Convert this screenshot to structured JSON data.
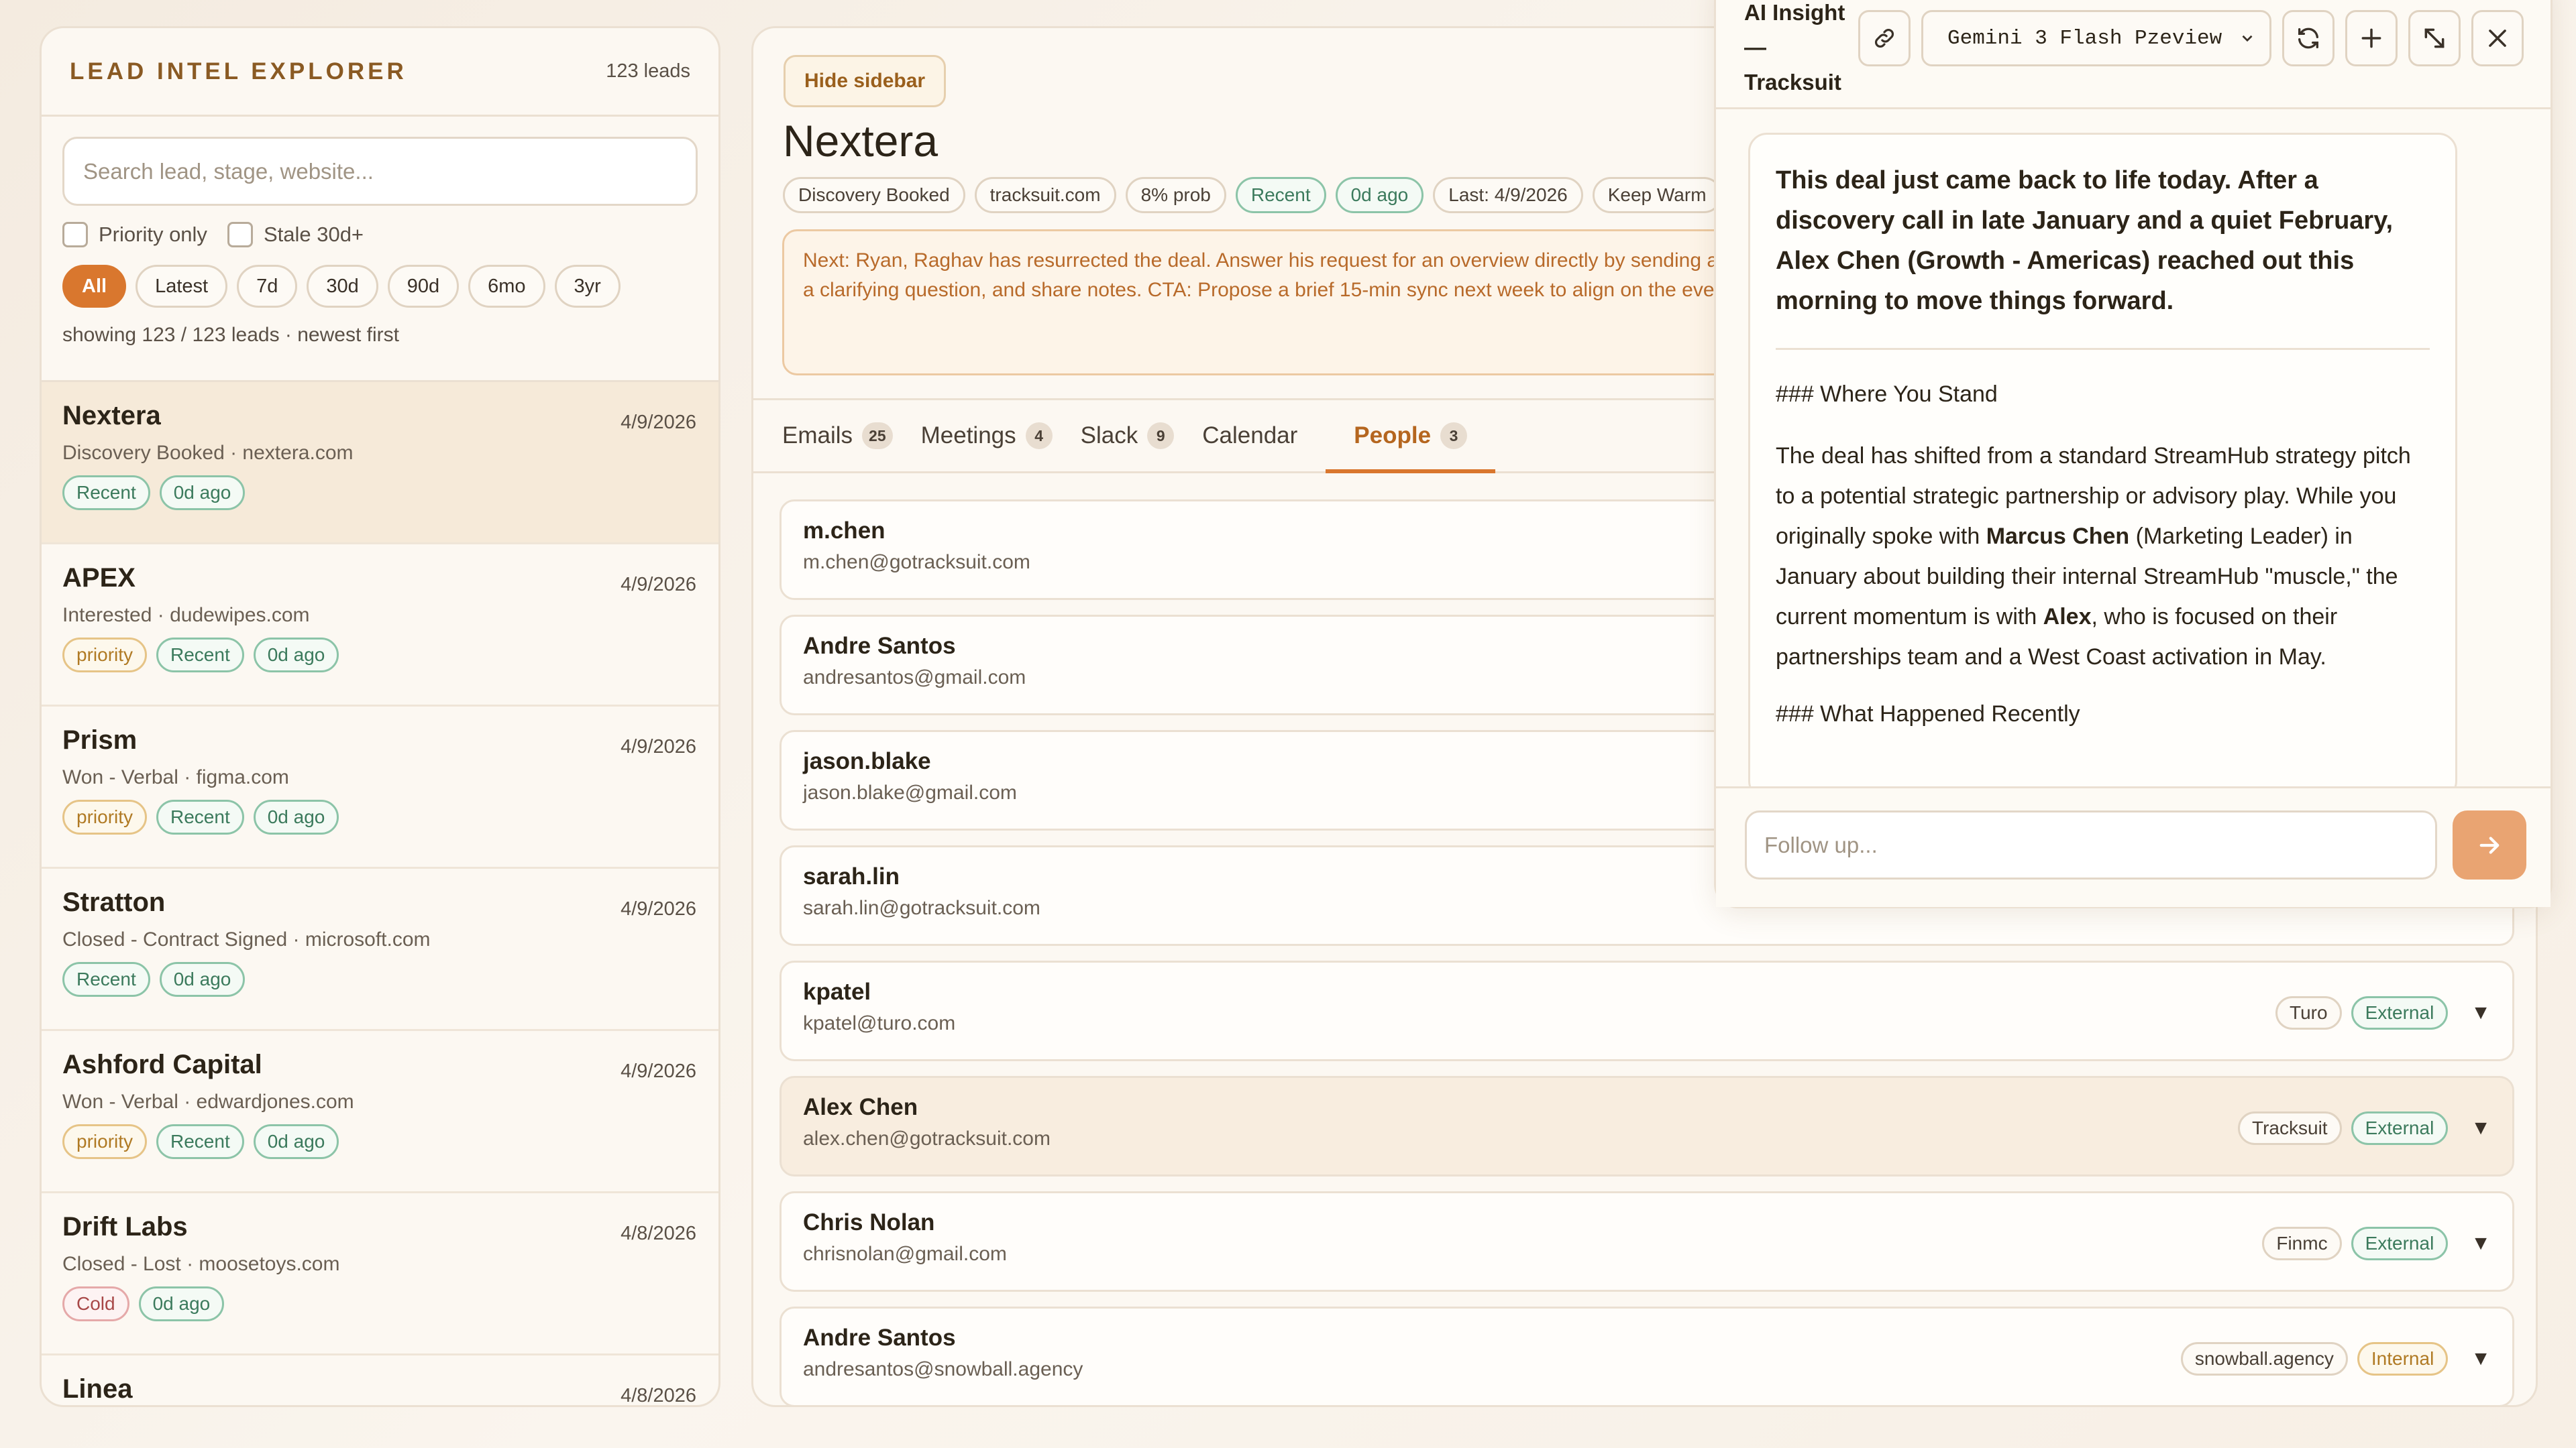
{
  "sidebar": {
    "title": "LEAD INTEL EXPLORER",
    "count": "123 leads",
    "search_placeholder": "Search lead, stage, website...",
    "priority_only": "Priority only",
    "stale": "Stale 30d+",
    "filters": [
      "All",
      "Latest",
      "7d",
      "30d",
      "90d",
      "6mo",
      "3yr"
    ],
    "active_filter": "All",
    "showing": "showing 123 / 123 leads · newest first",
    "leads": [
      {
        "name": "Nextera",
        "date": "4/9/2026",
        "sub": "Discovery Booked · nextera.com",
        "tags": [
          "Recent",
          "0d ago"
        ],
        "selected": true
      },
      {
        "name": "APEX",
        "date": "4/9/2026",
        "sub": "Interested · dudewipes.com",
        "tags": [
          "priority",
          "Recent",
          "0d ago"
        ]
      },
      {
        "name": "Prism",
        "date": "4/9/2026",
        "sub": "Won - Verbal · figma.com",
        "tags": [
          "priority",
          "Recent",
          "0d ago"
        ]
      },
      {
        "name": "Stratton",
        "date": "4/9/2026",
        "sub": "Closed - Contract Signed · microsoft.com",
        "tags": [
          "Recent",
          "0d ago"
        ]
      },
      {
        "name": "Ashford Capital",
        "date": "4/9/2026",
        "sub": "Won - Verbal · edwardjones.com",
        "tags": [
          "priority",
          "Recent",
          "0d ago"
        ]
      },
      {
        "name": "Drift Labs",
        "date": "4/8/2026",
        "sub": "Closed - Lost · moosetoys.com",
        "tags": [
          "Cold",
          "0d ago"
        ]
      },
      {
        "name": "Linea",
        "date": "4/8/2026",
        "sub": "",
        "tags": []
      }
    ]
  },
  "main": {
    "hide_sidebar": "Hide sidebar",
    "title": "Nextera",
    "chips": [
      "Discovery Booked",
      "tracksuit.com",
      "8% prob",
      "Recent",
      "0d ago",
      "Last: 4/9/2026",
      "Keep Warm"
    ],
    "next_text": "Next: Ryan, Raghav has resurrected the deal. Answer his request for an overview directly by sending a brief proposal for the May 26th West Coast trip—express interest in the LA/SF dates. Ask a clarifying question, and share notes. CTA: Propose a brief 15-min sync next week to align on the event vision and the partnership",
    "tabs": [
      {
        "label": "Emails",
        "badge": "25"
      },
      {
        "label": "Meetings",
        "badge": "4"
      },
      {
        "label": "Slack",
        "badge": "9"
      },
      {
        "label": "Calendar",
        "badge": ""
      },
      {
        "label": "People",
        "badge": "3"
      }
    ],
    "active_tab": "People",
    "people": [
      {
        "name": "m.chen",
        "email": "m.chen@gotracksuit.com",
        "org": "",
        "type": ""
      },
      {
        "name": "Andre Santos",
        "email": "andresantos@gmail.com",
        "org": "",
        "type": ""
      },
      {
        "name": "jason.blake",
        "email": "jason.blake@gmail.com",
        "org": "",
        "type": ""
      },
      {
        "name": "sarah.lin",
        "email": "sarah.lin@gotracksuit.com",
        "org": "",
        "type": ""
      },
      {
        "name": "kpatel",
        "email": "kpatel@turo.com",
        "org": "Turo",
        "type": "External"
      },
      {
        "name": "Alex Chen",
        "email": "alex.chen@gotracksuit.com",
        "org": "Tracksuit",
        "type": "External",
        "highlight": true
      },
      {
        "name": "Chris Nolan",
        "email": "chrisnolan@gmail.com",
        "org": "Finmc",
        "type": "External"
      },
      {
        "name": "Andre Santos",
        "email": "andresantos@snowball.agency",
        "org": "snowball.agency",
        "type": "Internal"
      }
    ]
  },
  "ai": {
    "title": "AI Insight\n—\nTracksuit",
    "model": "Gemini 3 Flash Pzeview",
    "lead_text": "This deal just came back to life today. After a discovery call in late January and a quiet February, Alex Chen (Growth - Americas) reached out this morning to move things forward.",
    "h1": "### Where You Stand",
    "p1_a": "The deal has shifted from a standard StreamHub strategy pitch to a potential strategic partnership or advisory play. While you originally spoke with ",
    "p1_b": "Marcus Chen",
    "p1_c": " (Marketing Leader) in January about building their internal StreamHub \"muscle,\" the current momentum is with ",
    "p1_d": "Alex",
    "p1_e": ", who is focused on their partnerships team and a West Coast activation in May.",
    "h2": "### What Happened Recently",
    "followup_placeholder": "Follow up..."
  }
}
